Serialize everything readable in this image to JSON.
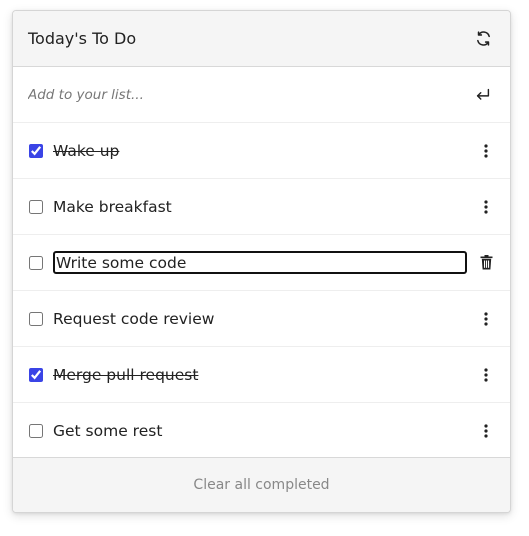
{
  "header": {
    "title": "Today's To Do",
    "refresh_icon": "refresh-icon"
  },
  "add": {
    "placeholder": "Add to your list...",
    "submit_icon": "enter-return-icon"
  },
  "items": [
    {
      "label": "Wake up",
      "completed": true,
      "editing": false,
      "action_icon": "vertical-dots-icon"
    },
    {
      "label": "Make breakfast",
      "completed": false,
      "editing": false,
      "action_icon": "vertical-dots-icon"
    },
    {
      "label": "Write some code",
      "completed": false,
      "editing": true,
      "action_icon": "trash-icon"
    },
    {
      "label": "Request code review",
      "completed": false,
      "editing": false,
      "action_icon": "vertical-dots-icon"
    },
    {
      "label": "Merge pull request",
      "completed": true,
      "editing": false,
      "action_icon": "vertical-dots-icon"
    },
    {
      "label": "Get some rest",
      "completed": false,
      "editing": false,
      "action_icon": "vertical-dots-icon"
    }
  ],
  "footer": {
    "clear_label": "Clear all completed"
  },
  "colors": {
    "checkbox_accent": "#3a44e6",
    "header_bg": "#f5f5f5",
    "footer_text": "#888888"
  }
}
